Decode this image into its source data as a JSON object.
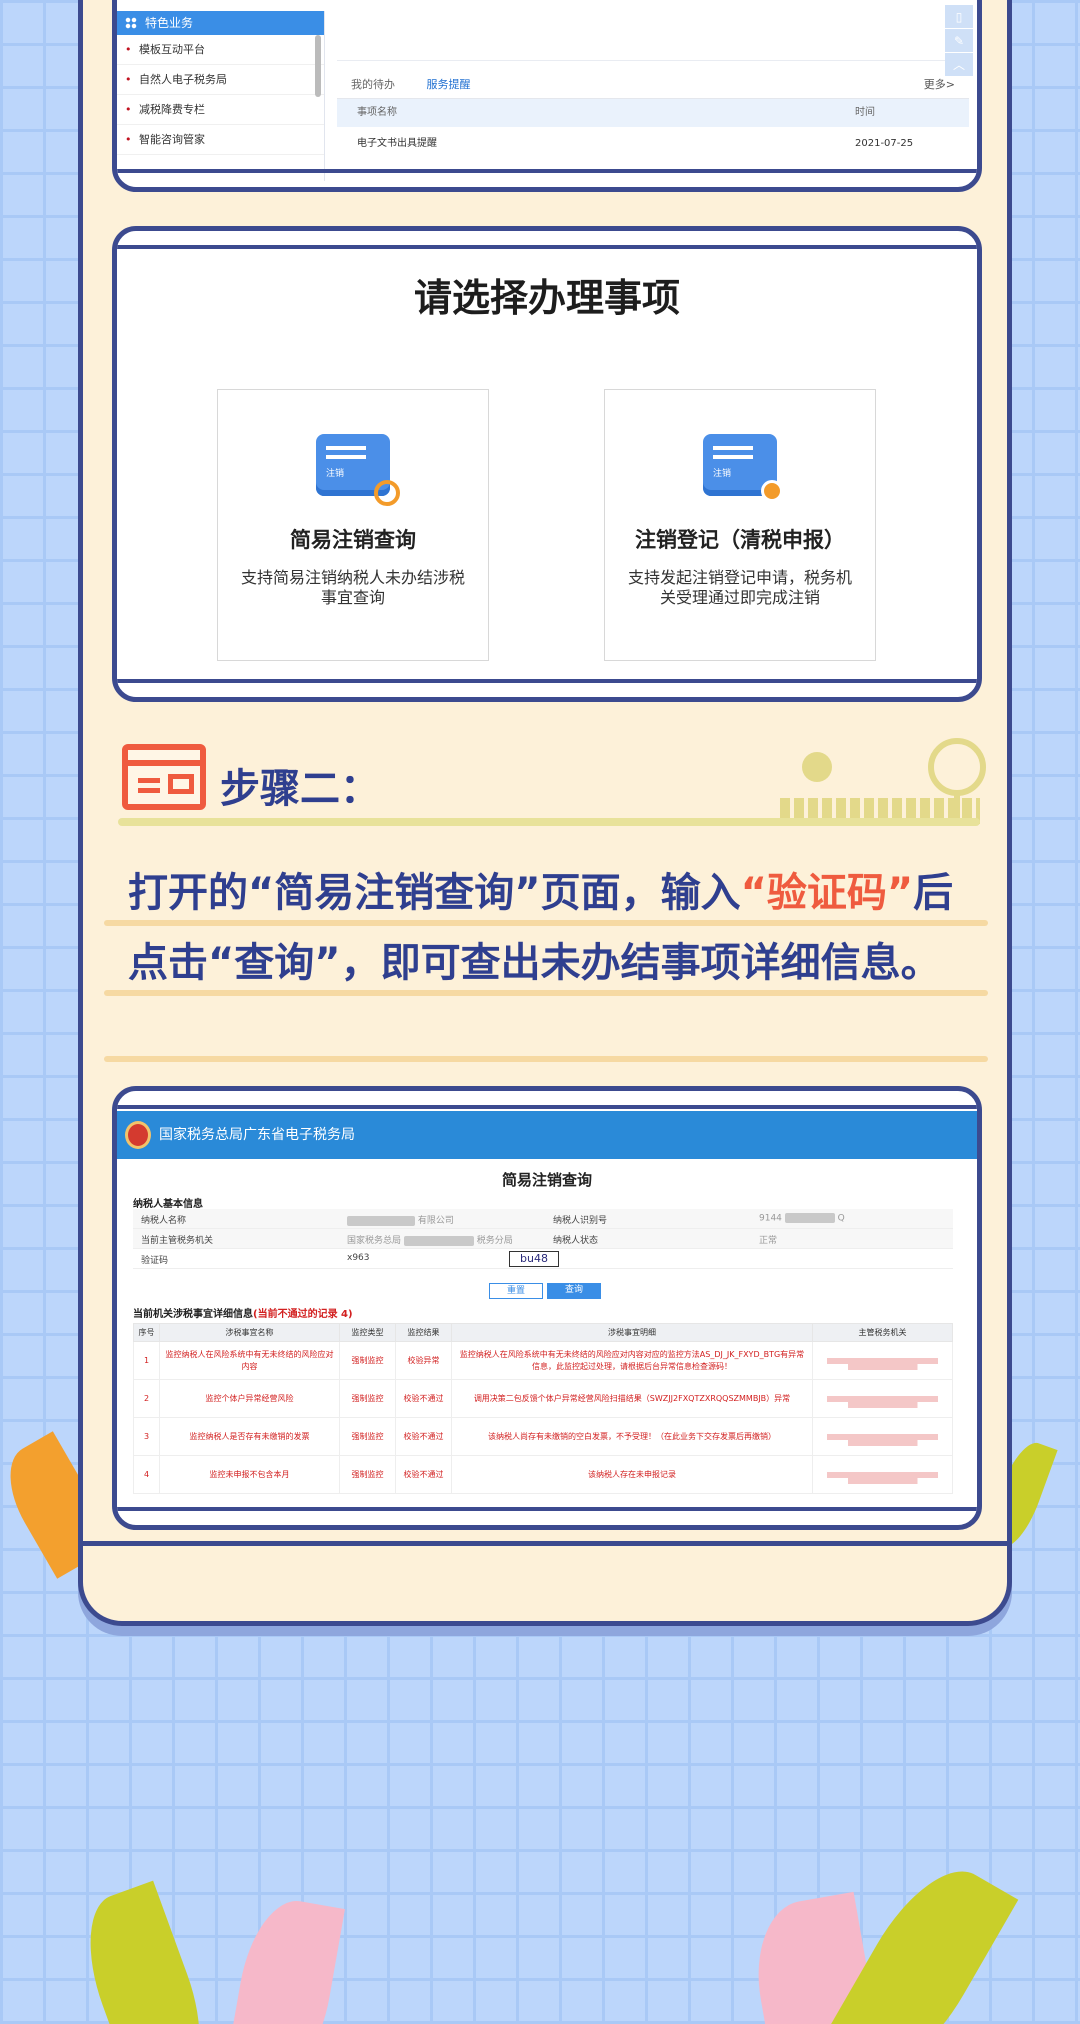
{
  "frame1": {
    "sidebar_header": "特色业务",
    "sidebar_items": [
      "模板互动平台",
      "自然人电子税务局",
      "减税降费专栏",
      "智能咨询管家"
    ],
    "tabs": [
      "我的待办",
      "服务提醒"
    ],
    "more": "更多>",
    "table_headers": [
      "事项名称",
      "时间"
    ],
    "rows": [
      {
        "name": "电子文书出具提醒",
        "date": "2021-07-25"
      }
    ]
  },
  "frame2": {
    "title": "请选择办理事项",
    "cards": [
      {
        "title": "简易注销查询",
        "desc": "支持简易注销纳税人未办结涉税事宜查询",
        "icon_tag": "注销"
      },
      {
        "title": "注销登记（清税申报）",
        "desc": "支持发起注销登记申请，税务机关受理通过即完成注销",
        "icon_tag": "注销"
      }
    ]
  },
  "step": {
    "title": "步骤二：",
    "para_before": "打开的“简易注销查询”页面，输入",
    "para_highlight": "“验证码”",
    "para_after": "后点击“查询”，即可查出未办结事项详细信息。"
  },
  "frame3": {
    "header": "国家税务总局广东省电子税务局",
    "title": "简易注销查询",
    "basic_info_label": "纳税人基本信息",
    "info_rows": [
      {
        "l1": "纳税人名称",
        "v1": "有限公司",
        "l2": "纳税人识别号",
        "v2": "9144",
        "v2b": "Q"
      },
      {
        "l1": "当前主管税务机关",
        "v1": "国家税务总局",
        "v1b": "税务分局",
        "l2": "纳税人状态",
        "v2": "正常"
      },
      {
        "l1": "验证码",
        "v1": "x963",
        "captcha": "bu48"
      }
    ],
    "reset_label": "重置",
    "query_label": "查询",
    "detail_label": "当前机关涉税事宜详细信息",
    "detail_count": "(当前不通过的记录 4)",
    "table_headers": [
      "序号",
      "涉税事宜名称",
      "监控类型",
      "监控结果",
      "涉税事宜明细",
      "主管税务机关"
    ],
    "table_rows": [
      {
        "no": "1",
        "name": "监控纳税人在风险系统中有无未终结的风险应对内容",
        "type": "强制监控",
        "result": "校验异常",
        "detail": "监控纳税人在风险系统中有无未终结的风险应对内容对应的监控方法AS_DJ_JK_FXYD_BTG有异常信息，此监控起过处理，请根据后台异常信息检查源码！"
      },
      {
        "no": "2",
        "name": "监控个体户异常经营风险",
        "type": "强制监控",
        "result": "校验不通过",
        "detail": "调用决策二包反馈个体户异常经营风险扫描结果（SWZJJ2FXQTZXRQQSZMMBJB）异常"
      },
      {
        "no": "3",
        "name": "监控纳税人是否存有未缴销的发票",
        "type": "强制监控",
        "result": "校验不通过",
        "detail": "该纳税人尚存有未缴销的空白发票，不予受理！（在此业务下交存发票后再缴销）"
      },
      {
        "no": "4",
        "name": "监控未申报不包含本月",
        "type": "强制监控",
        "result": "校验不通过",
        "detail": "该纳税人存在未申报记录"
      }
    ]
  }
}
